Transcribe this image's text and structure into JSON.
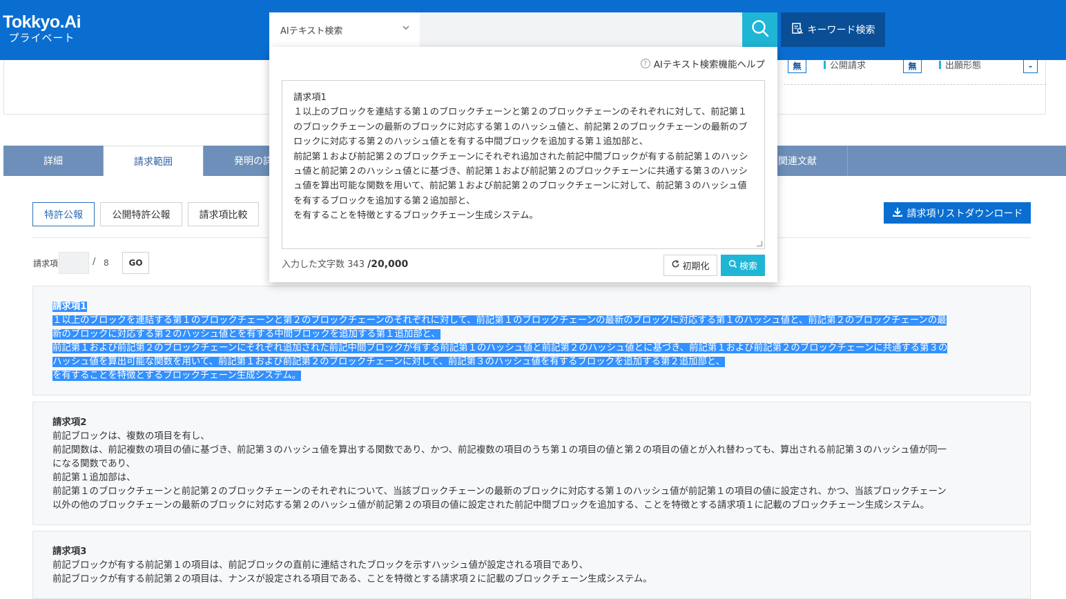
{
  "header": {
    "logo_main": "Tokkyo.Ai",
    "logo_sub": "プライベート",
    "search_mode": "AIテキスト検索",
    "keyword_button": "キーワード検索",
    "search_icon": "search-icon"
  },
  "overlay": {
    "help_label": "AIテキスト検索機能ヘルプ",
    "query_text": "請求項1\n１以上のブロックを連結する第１のブロックチェーンと第２のブロックチェーンのそれぞれに対して、前記第１のブロックチェーンの最新のブロックに対応する第１のハッシュ値と、前記第２のブロックチェーンの最新のブロックに対応する第２のハッシュ値とを有する中間ブロックを追加する第１追加部と、\n前記第１および前記第２のブロックチェーンにそれぞれ追加された前記中間ブロックが有する前記第１のハッシュ値と前記第２のハッシュ値とに基づき、前記第１および前記第２のブロックチェーンに共通する第３のハッシュ値を算出可能な関数を用いて、前記第１および前記第２のブロックチェーンに対して、前記第３のハッシュ値を有するブロックを追加する第２追加部と、\nを有することを特徴とするブロックチェーン生成システム。",
    "count_label": "入力した文字数",
    "count_value": "343",
    "count_max": "/20,000",
    "reset_label": "初期化",
    "search_label": "検索"
  },
  "info_row": {
    "flag1": "無",
    "item1": "公開請求",
    "flag2": "無",
    "item2": "出願形態",
    "flag3": "-"
  },
  "tabs": [
    {
      "label": "詳細"
    },
    {
      "label": "請求範囲"
    },
    {
      "label": "発明の詳"
    },
    {
      "label": "関連文献"
    }
  ],
  "sub_buttons": {
    "patent": "特許公報",
    "published": "公開特許公報",
    "compare": "請求項比較",
    "download": "請求項リストダウンロード"
  },
  "claim_nav": {
    "label": "請求項",
    "slash": "/",
    "total": "8",
    "go": "GO"
  },
  "claims": [
    {
      "title": "請求項1",
      "lines": [
        "１以上のブロックを連結する第１のブロックチェーンと第２のブロックチェーンのそれぞれに対して、前記第１のブロックチェーンの最新のブロックに対応する第１のハッシュ値と、前記第２のブロックチェーンの最",
        "新のブロックに対応する第２のハッシュ値とを有する中間ブロックを追加する第１追加部と、",
        "前記第１および前記第２のブロックチェーンにそれぞれ追加された前記中間ブロックが有する前記第１のハッシュ値と前記第２のハッシュ値とに基づき、前記第１および前記第２のブロックチェーンに共通する第３の",
        "ハッシュ値を算出可能な関数を用いて、前記第１および前記第２のブロックチェーンに対して、前記第３のハッシュ値を有するブロックを追加する第２追加部と、",
        "を有することを特徴とするブロックチェーン生成システム。"
      ]
    },
    {
      "title": "請求項2",
      "lines": [
        "前記ブロックは、複数の項目を有し、",
        "前記関数は、前記複数の項目の値に基づき、前記第３のハッシュ値を算出する関数であり、かつ、前記複数の項目のうち第１の項目の値と第２の項目の値とが入れ替わっても、算出される前記第３のハッシュ値が同一",
        "になる関数であり、",
        "前記第１追加部は、",
        "前記第１のブロックチェーンと前記第２のブロックチェーンのそれぞれについて、当該ブロックチェーンの最新のブロックに対応する第１のハッシュ値が前記第１の項目の値に設定され、かつ、当該ブロックチェーン",
        "以外の他のブロックチェーンの最新のブロックに対応する第２のハッシュ値が前記第２の項目の値に設定された前記中間ブロックを追加する、ことを特徴とする請求項１に記載のブロックチェーン生成システム。"
      ]
    },
    {
      "title": "請求項3",
      "lines": [
        "前記ブロックが有する前記第１の項目は、前記ブロックの直前に連結されたブロックを示すハッシュ値が設定される項目であり、",
        "前記ブロックが有する前記第２の項目は、ナンスが設定される項目である、ことを特徴とする請求項２に記載のブロックチェーン生成システム。"
      ]
    }
  ]
}
